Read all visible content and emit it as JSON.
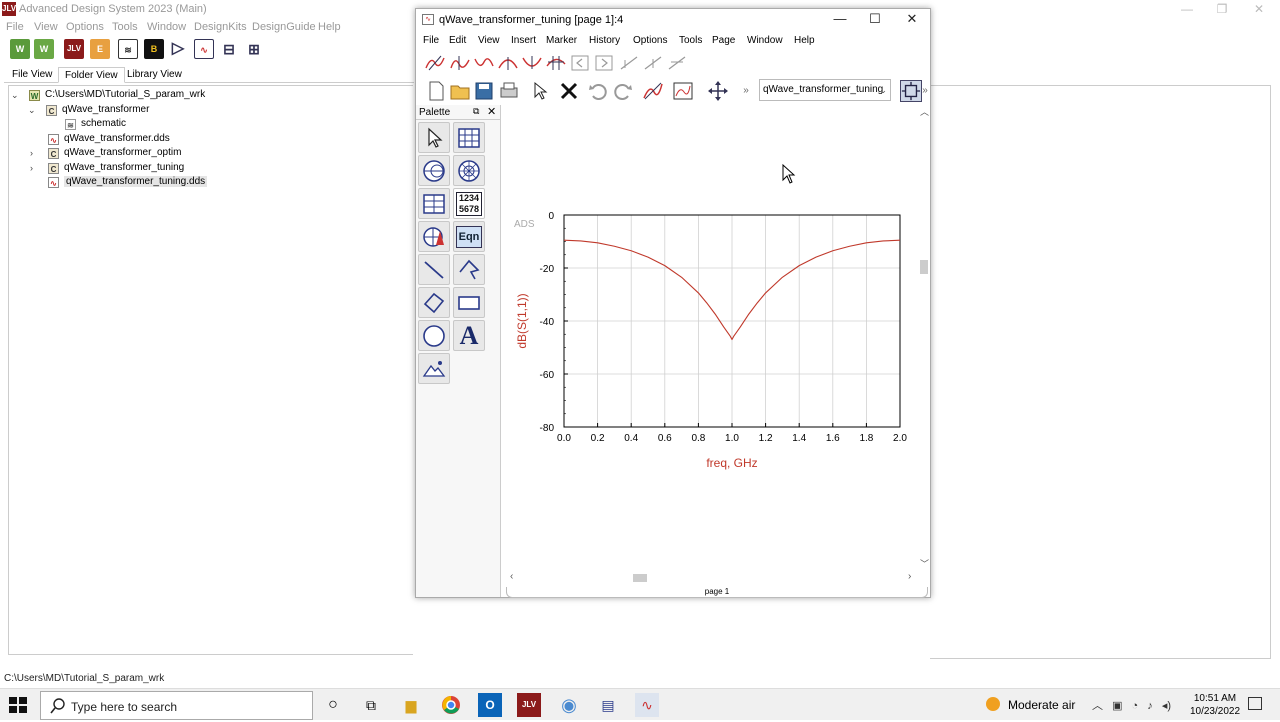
{
  "main_window": {
    "title": "Advanced Design System 2023 (Main)",
    "logo_text": "JLV",
    "controls": {
      "minimize": "—",
      "maximize": "❐",
      "close": "✕"
    },
    "menu": [
      "File",
      "View",
      "Options",
      "Tools",
      "Window",
      "DesignKits",
      "DesignGuide",
      "Help"
    ],
    "toolbar_icons": [
      "new-workspace",
      "open-workspace",
      "ads-logo",
      "design-guide",
      "schematic",
      "layout",
      "symbol",
      "data-display",
      "library",
      "hierarchy"
    ],
    "tabs": [
      "File View",
      "Folder View",
      "Library View"
    ],
    "active_tab": "Folder View",
    "tree": [
      {
        "label": "C:\\Users\\MD\\Tutorial_S_param_wrk",
        "type": "workspace",
        "expanded": true
      },
      {
        "label": "qWave_transformer",
        "type": "cell",
        "expanded": true
      },
      {
        "label": "schematic",
        "type": "schematic"
      },
      {
        "label": "qWave_transformer.dds",
        "type": "dds"
      },
      {
        "label": "qWave_transformer_optim",
        "type": "cell",
        "expanded": false
      },
      {
        "label": "qWave_transformer_tuning",
        "type": "cell",
        "expanded": false
      },
      {
        "label": "qWave_transformer_tuning.dds",
        "type": "dds",
        "selected": true
      }
    ],
    "status": "C:\\Users\\MD\\Tutorial_S_param_wrk"
  },
  "dd_window": {
    "title": "qWave_transformer_tuning [page 1]:4",
    "controls": {
      "minimize": "—",
      "maximize": "☐",
      "close": "✕"
    },
    "menu": [
      "File",
      "Edit",
      "View",
      "Insert",
      "Marker",
      "History",
      "Options",
      "Tools",
      "Page",
      "Window",
      "Help"
    ],
    "page_select": "qWave_transformer_tuning",
    "overflow": "»",
    "palette": {
      "title": "Palette",
      "items": [
        "pointer",
        "rectangular-plot",
        "smith-chart",
        "polar-plot",
        "stack-plot",
        "list",
        "antenna-plot",
        "equation",
        "line",
        "polyline",
        "polygon",
        "rectangle",
        "circle",
        "text",
        "image"
      ],
      "list_label_1": "1234",
      "list_label_2": "5678",
      "eqn_label": "Eqn",
      "text_label": "A"
    },
    "page_tab": "page 1"
  },
  "chart_data": {
    "type": "line",
    "watermark": "ADS",
    "xlabel": "freq, GHz",
    "ylabel": "dB(S(1,1))",
    "xlim": [
      0.0,
      2.0
    ],
    "ylim": [
      -80,
      0
    ],
    "x_ticks": [
      "0.0",
      "0.2",
      "0.4",
      "0.6",
      "0.8",
      "1.0",
      "1.2",
      "1.4",
      "1.6",
      "1.8",
      "2.0"
    ],
    "y_ticks": [
      "0",
      "-20",
      "-40",
      "-60",
      "-80"
    ],
    "grid": true,
    "color": "#c0392b",
    "series": [
      {
        "x": [
          0.0,
          0.1,
          0.2,
          0.3,
          0.4,
          0.5,
          0.6,
          0.7,
          0.8,
          0.85,
          0.9,
          0.95,
          0.97,
          0.99,
          1.0,
          1.01,
          1.03,
          1.05,
          1.1,
          1.15,
          1.2,
          1.3,
          1.4,
          1.5,
          1.6,
          1.7,
          1.8,
          1.9,
          2.0
        ],
        "values": [
          -9.5,
          -9.8,
          -10.5,
          -11.8,
          -13.5,
          -15.9,
          -19.1,
          -23.5,
          -29.4,
          -33.2,
          -37.4,
          -42.2,
          -44.0,
          -45.8,
          -47.0,
          -45.8,
          -44.0,
          -42.2,
          -37.4,
          -33.2,
          -29.4,
          -23.5,
          -19.1,
          -15.9,
          -13.5,
          -11.8,
          -10.5,
          -9.8,
          -9.5
        ]
      }
    ]
  },
  "taskbar": {
    "search_placeholder": "Type here to search",
    "weather": "Moderate air",
    "time": "10:51 AM",
    "date": "10/23/2022"
  }
}
